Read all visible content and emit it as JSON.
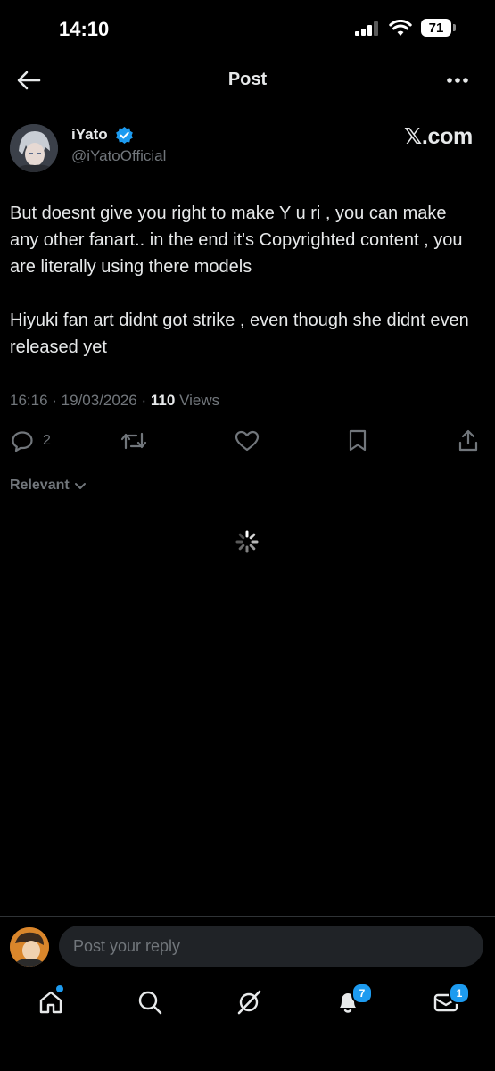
{
  "status_bar": {
    "time": "14:10",
    "battery": "71"
  },
  "header": {
    "title": "Post"
  },
  "post": {
    "author_name": "iYato",
    "author_handle": "@iYatoOfficial",
    "source": "𝕏.com",
    "paragraphs": [
      "But doesnt give you right to make Y u ri , you can make any other fanart.. in the end it's Copyrighted content , you are literally using there models",
      "Hiyuki fan art didnt got strike , even though she didnt even released yet"
    ],
    "time": "16:16",
    "date": "19/03/2026",
    "views_count": "110",
    "views_label": "Views",
    "reply_count": "2"
  },
  "replies": {
    "sort_label": "Relevant"
  },
  "composer": {
    "placeholder": "Post your reply"
  },
  "tab_bar": {
    "notifications_badge": "7",
    "messages_badge": "1"
  },
  "colors": {
    "accent": "#1d9bf0",
    "background": "#000000",
    "muted": "#71767b"
  },
  "icons": [
    "back-arrow-icon",
    "more-icon",
    "verified-icon",
    "reply-icon",
    "repost-icon",
    "like-icon",
    "bookmark-icon",
    "share-icon",
    "chevron-down-icon",
    "spinner-icon",
    "home-icon",
    "search-icon",
    "grok-icon",
    "bell-icon",
    "mail-icon"
  ]
}
